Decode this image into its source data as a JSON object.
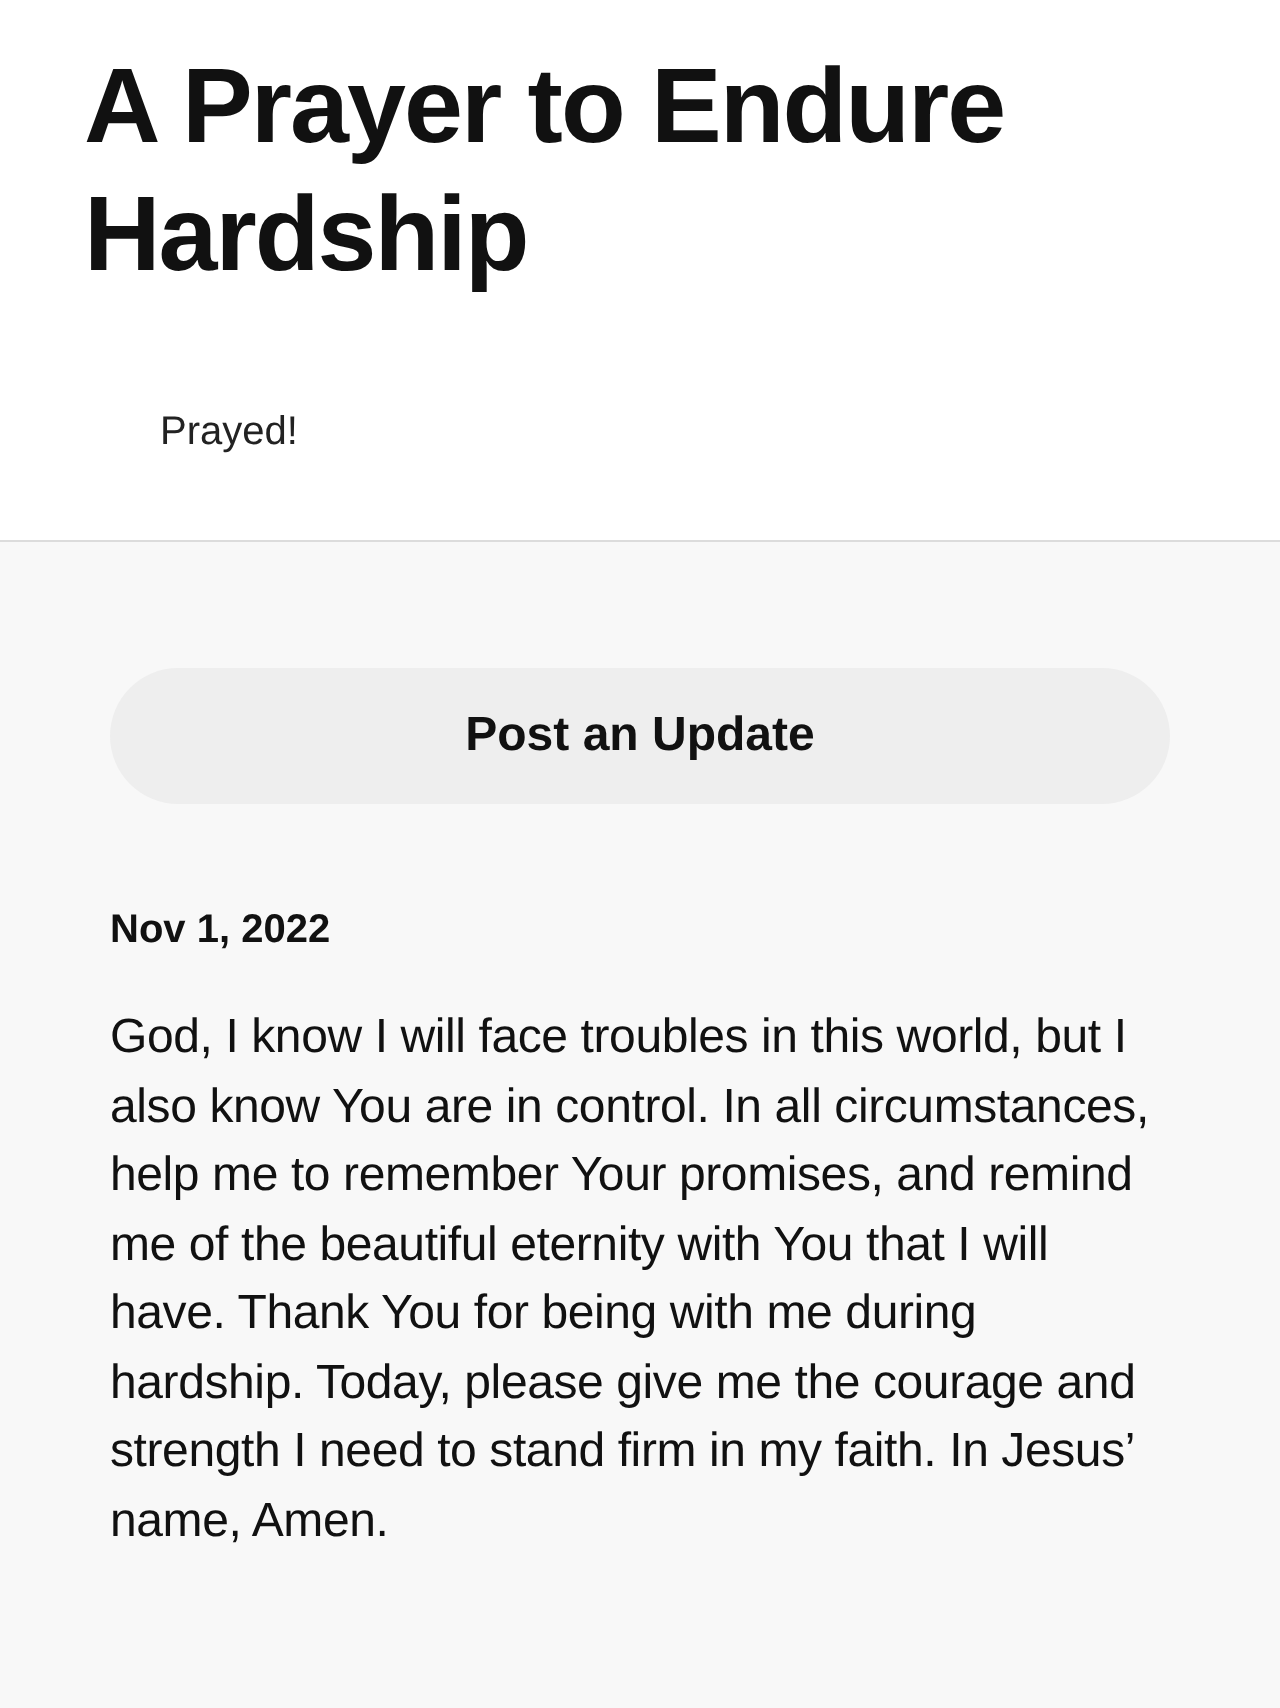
{
  "title": "A Prayer to Endure Hardship",
  "prayed_label": "Prayed!",
  "update_button": "Post an Update",
  "entry": {
    "date": "Nov 1, 2022",
    "text": "God, I know I will face troubles in this world, but I also know You are in control. In all circumstances, help me to remember Your promises, and remind me of the beautiful eternity with You that I will have. Thank You for being with me during hardship. Today, please give me the courage and strength I need to stand firm in my faith. In Jesus’ name, Amen."
  }
}
